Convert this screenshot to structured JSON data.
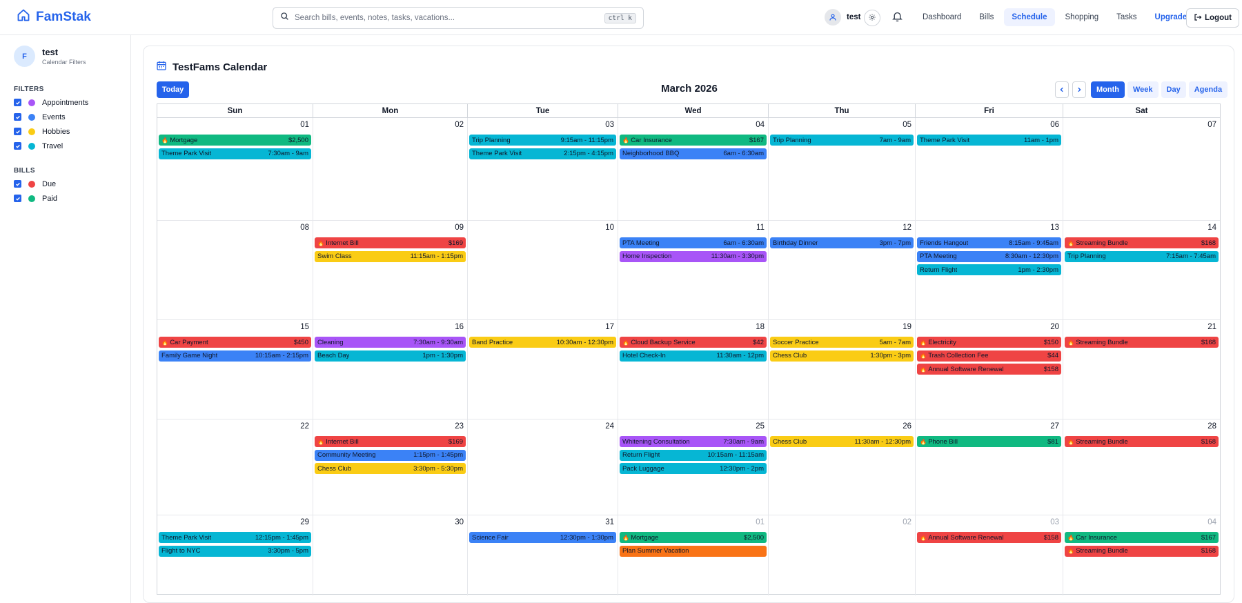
{
  "app": {
    "name": "FamStak"
  },
  "search": {
    "placeholder": "Search bills, events, notes, tasks, vacations...",
    "shortcut": "ctrl k"
  },
  "user": {
    "name": "test",
    "initial": "F",
    "subtitle": "Calendar Filters"
  },
  "nav": {
    "items": [
      {
        "label": "Dashboard",
        "active": false
      },
      {
        "label": "Bills",
        "active": false
      },
      {
        "label": "Schedule",
        "active": true
      },
      {
        "label": "Shopping",
        "active": false
      },
      {
        "label": "Tasks",
        "active": false
      }
    ],
    "upgrade": "Upgrade",
    "logout": "Logout"
  },
  "colors": {
    "teal": "#06b6d4",
    "green": "#10b981",
    "blue": "#3b82f6",
    "red": "#ef4444",
    "yellow": "#facc15",
    "purple": "#a855f7",
    "orange": "#f97316",
    "accent": "#2563eb"
  },
  "sidebar": {
    "filters_title": "FILTERS",
    "filters": [
      {
        "label": "Appointments",
        "color": "#a855f7"
      },
      {
        "label": "Events",
        "color": "#3b82f6"
      },
      {
        "label": "Hobbies",
        "color": "#facc15"
      },
      {
        "label": "Travel",
        "color": "#06b6d4"
      }
    ],
    "bills_title": "BILLS",
    "bills": [
      {
        "label": "Due",
        "color": "#ef4444"
      },
      {
        "label": "Paid",
        "color": "#10b981"
      }
    ]
  },
  "calendar": {
    "title": "TestFams Calendar",
    "today_label": "Today",
    "month_label": "March 2026",
    "views": [
      {
        "label": "Month",
        "active": true
      },
      {
        "label": "Week",
        "active": false
      },
      {
        "label": "Day",
        "active": false
      },
      {
        "label": "Agenda",
        "active": false
      }
    ],
    "weekdays": [
      "Sun",
      "Mon",
      "Tue",
      "Wed",
      "Thu",
      "Fri",
      "Sat"
    ],
    "weeks": [
      [
        {
          "day": "01",
          "events": [
            {
              "title": "Mortgage",
              "right": "$2,500",
              "color": "green",
              "bill": true
            },
            {
              "title": "Theme Park Visit",
              "right": "7:30am - 9am",
              "color": "teal"
            }
          ]
        },
        {
          "day": "02",
          "events": []
        },
        {
          "day": "03",
          "events": [
            {
              "title": "Trip Planning",
              "right": "9:15am - 11:15pm",
              "color": "teal"
            },
            {
              "title": "Theme Park Visit",
              "right": "2:15pm - 4:15pm",
              "color": "teal"
            }
          ]
        },
        {
          "day": "04",
          "events": [
            {
              "title": "Car Insurance",
              "right": "$167",
              "color": "green",
              "bill": true
            },
            {
              "title": "Neighborhood BBQ",
              "right": "6am - 6:30am",
              "color": "blue"
            }
          ]
        },
        {
          "day": "05",
          "events": [
            {
              "title": "Trip Planning",
              "right": "7am - 9am",
              "color": "teal"
            }
          ]
        },
        {
          "day": "06",
          "events": [
            {
              "title": "Theme Park Visit",
              "right": "11am - 1pm",
              "color": "teal"
            }
          ]
        },
        {
          "day": "07",
          "events": []
        }
      ],
      [
        {
          "day": "08",
          "events": []
        },
        {
          "day": "09",
          "events": [
            {
              "title": "Internet Bill",
              "right": "$169",
              "color": "red",
              "bill": true
            },
            {
              "title": "Swim Class",
              "right": "11:15am - 1:15pm",
              "color": "yellow"
            }
          ]
        },
        {
          "day": "10",
          "events": []
        },
        {
          "day": "11",
          "events": [
            {
              "title": "PTA Meeting",
              "right": "6am - 6:30am",
              "color": "blue"
            },
            {
              "title": "Home Inspection",
              "right": "11:30am - 3:30pm",
              "color": "purple"
            }
          ]
        },
        {
          "day": "12",
          "events": [
            {
              "title": "Birthday Dinner",
              "right": "3pm - 7pm",
              "color": "blue"
            }
          ]
        },
        {
          "day": "13",
          "events": [
            {
              "title": "Friends Hangout",
              "right": "8:15am - 9:45am",
              "color": "blue"
            },
            {
              "title": "PTA Meeting",
              "right": "8:30am - 12:30pm",
              "color": "blue"
            },
            {
              "title": "Return Flight",
              "right": "1pm - 2:30pm",
              "color": "teal"
            }
          ]
        },
        {
          "day": "14",
          "events": [
            {
              "title": "Streaming Bundle",
              "right": "$168",
              "color": "red",
              "bill": true
            },
            {
              "title": "Trip Planning",
              "right": "7:15am - 7:45am",
              "color": "teal"
            }
          ]
        }
      ],
      [
        {
          "day": "15",
          "events": [
            {
              "title": "Car Payment",
              "right": "$450",
              "color": "red",
              "bill": true
            },
            {
              "title": "Family Game Night",
              "right": "10:15am - 2:15pm",
              "color": "blue"
            }
          ]
        },
        {
          "day": "16",
          "events": [
            {
              "title": "Cleaning",
              "right": "7:30am - 9:30am",
              "color": "purple"
            },
            {
              "title": "Beach Day",
              "right": "1pm - 1:30pm",
              "color": "teal"
            }
          ]
        },
        {
          "day": "17",
          "events": [
            {
              "title": "Band Practice",
              "right": "10:30am - 12:30pm",
              "color": "yellow"
            }
          ]
        },
        {
          "day": "18",
          "events": [
            {
              "title": "Cloud Backup Service",
              "right": "$42",
              "color": "red",
              "bill": true
            },
            {
              "title": "Hotel Check-In",
              "right": "11:30am - 12pm",
              "color": "teal"
            }
          ]
        },
        {
          "day": "19",
          "events": [
            {
              "title": "Soccer Practice",
              "right": "5am - 7am",
              "color": "yellow"
            },
            {
              "title": "Chess Club",
              "right": "1:30pm - 3pm",
              "color": "yellow"
            }
          ]
        },
        {
          "day": "20",
          "events": [
            {
              "title": "Electricity",
              "right": "$150",
              "color": "red",
              "bill": true
            },
            {
              "title": "Trash Collection Fee",
              "right": "$44",
              "color": "red",
              "bill": true
            },
            {
              "title": "Annual Software Renewal",
              "right": "$158",
              "color": "red",
              "bill": true
            }
          ]
        },
        {
          "day": "21",
          "events": [
            {
              "title": "Streaming Bundle",
              "right": "$168",
              "color": "red",
              "bill": true
            }
          ]
        }
      ],
      [
        {
          "day": "22",
          "events": []
        },
        {
          "day": "23",
          "events": [
            {
              "title": "Internet Bill",
              "right": "$169",
              "color": "red",
              "bill": true
            },
            {
              "title": "Community Meeting",
              "right": "1:15pm - 1:45pm",
              "color": "blue"
            },
            {
              "title": "Chess Club",
              "right": "3:30pm - 5:30pm",
              "color": "yellow"
            }
          ]
        },
        {
          "day": "24",
          "events": []
        },
        {
          "day": "25",
          "events": [
            {
              "title": "Whitening Consultation",
              "right": "7:30am - 9am",
              "color": "purple"
            },
            {
              "title": "Return Flight",
              "right": "10:15am - 11:15am",
              "color": "teal"
            },
            {
              "title": "Pack Luggage",
              "right": "12:30pm - 2pm",
              "color": "teal"
            }
          ]
        },
        {
          "day": "26",
          "events": [
            {
              "title": "Chess Club",
              "right": "11:30am - 12:30pm",
              "color": "yellow"
            }
          ]
        },
        {
          "day": "27",
          "events": [
            {
              "title": "Phone Bill",
              "right": "$81",
              "color": "green",
              "bill": true
            }
          ]
        },
        {
          "day": "28",
          "events": [
            {
              "title": "Streaming Bundle",
              "right": "$168",
              "color": "red",
              "bill": true
            }
          ]
        }
      ],
      [
        {
          "day": "29",
          "events": [
            {
              "title": "Theme Park Visit",
              "right": "12:15pm - 1:45pm",
              "color": "teal"
            },
            {
              "title": "Flight to NYC",
              "right": "3:30pm - 5pm",
              "color": "teal"
            }
          ]
        },
        {
          "day": "30",
          "events": []
        },
        {
          "day": "31",
          "events": [
            {
              "title": "Science Fair",
              "right": "12:30pm - 1:30pm",
              "color": "blue"
            }
          ]
        },
        {
          "day": "01",
          "other": true,
          "events": [
            {
              "title": "Mortgage",
              "right": "$2,500",
              "color": "green",
              "bill": true
            },
            {
              "title": "Plan Summer Vacation",
              "right": "",
              "color": "orange"
            }
          ]
        },
        {
          "day": "02",
          "other": true,
          "events": []
        },
        {
          "day": "03",
          "other": true,
          "events": [
            {
              "title": "Annual Software Renewal",
              "right": "$158",
              "color": "red",
              "bill": true
            }
          ]
        },
        {
          "day": "04",
          "other": true,
          "events": [
            {
              "title": "Car Insurance",
              "right": "$167",
              "color": "green",
              "bill": true
            },
            {
              "title": "Streaming Bundle",
              "right": "$168",
              "color": "red",
              "bill": true
            }
          ]
        }
      ]
    ]
  }
}
